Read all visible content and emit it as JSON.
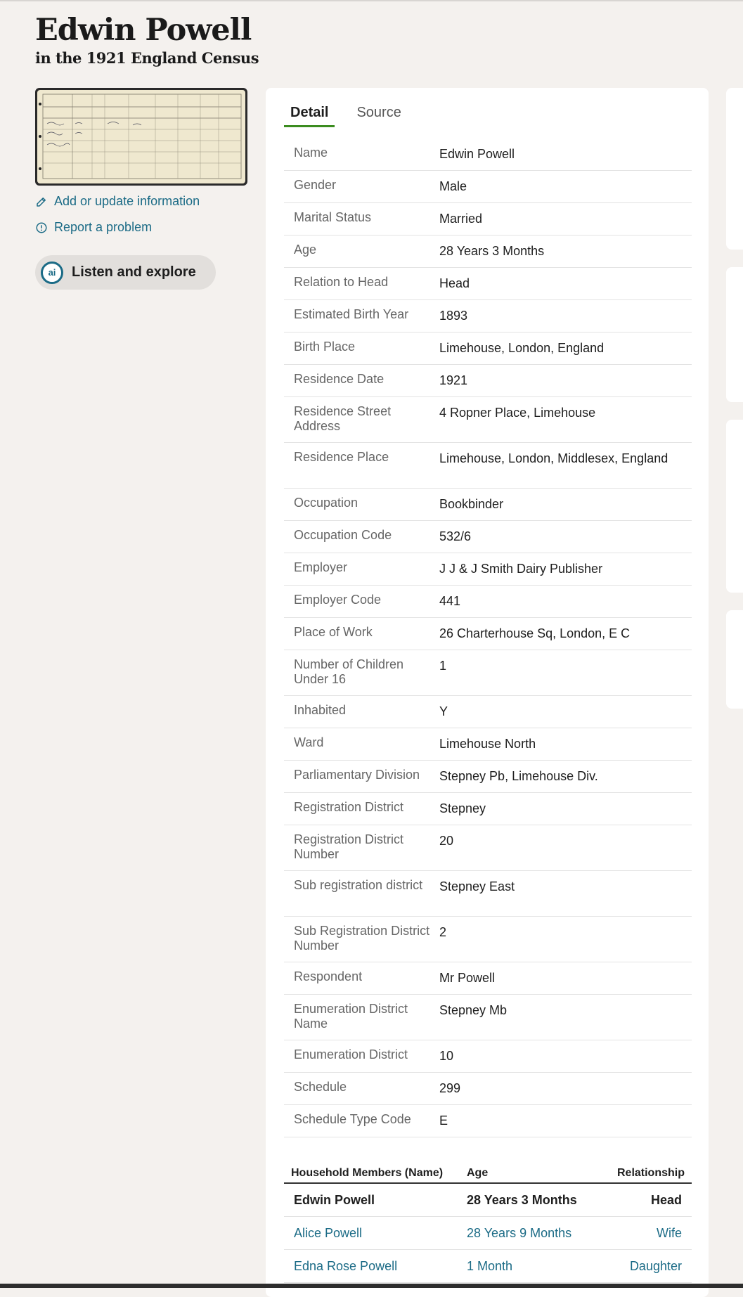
{
  "header": {
    "name": "Edwin Powell",
    "collection": "in the 1921 England Census"
  },
  "sidebar": {
    "add_update_label": "Add or update information",
    "report_label": "Report a problem",
    "listen_label": "Listen and explore",
    "ai_badge": "ai"
  },
  "tabs": [
    {
      "label": "Detail",
      "active": true
    },
    {
      "label": "Source",
      "active": false
    }
  ],
  "details": [
    {
      "label": "Name",
      "value": "Edwin Powell"
    },
    {
      "label": "Gender",
      "value": "Male"
    },
    {
      "label": "Marital Status",
      "value": "Married"
    },
    {
      "label": "Age",
      "value": "28 Years 3 Months"
    },
    {
      "label": "Relation to Head",
      "value": "Head"
    },
    {
      "label": "Estimated Birth Year",
      "value": "1893"
    },
    {
      "label": "Birth Place",
      "value": "Limehouse, London, England"
    },
    {
      "label": "Residence Date",
      "value": "1921"
    },
    {
      "label": "Residence Street Address",
      "value": "4 Ropner Place, Limehouse"
    },
    {
      "label": "Residence Place",
      "value": "Limehouse, London, Middlesex, England"
    },
    {
      "label": "Occupation",
      "value": "Bookbinder"
    },
    {
      "label": "Occupation Code",
      "value": "532/6"
    },
    {
      "label": "Employer",
      "value": "J J & J Smith Dairy Publisher"
    },
    {
      "label": "Employer Code",
      "value": "441"
    },
    {
      "label": "Place of Work",
      "value": "26 Charterhouse Sq, London, E C"
    },
    {
      "label": "Number of Children Under 16",
      "value": "1"
    },
    {
      "label": "Inhabited",
      "value": "Y"
    },
    {
      "label": "Ward",
      "value": "Limehouse North"
    },
    {
      "label": "Parliamentary Division",
      "value": "Stepney Pb, Limehouse Div."
    },
    {
      "label": "Registration District",
      "value": "Stepney"
    },
    {
      "label": "Registration District Number",
      "value": "20"
    },
    {
      "label": "Sub registration district",
      "value": "Stepney East"
    },
    {
      "label": "Sub Registration District Number",
      "value": "2"
    },
    {
      "label": "Respondent",
      "value": "Mr Powell"
    },
    {
      "label": "Enumeration District Name",
      "value": "Stepney Mb"
    },
    {
      "label": "Enumeration District",
      "value": "10"
    },
    {
      "label": "Schedule",
      "value": "299"
    },
    {
      "label": "Schedule Type Code",
      "value": "E"
    }
  ],
  "household": {
    "headers": [
      "Household Members (Name)",
      "Age",
      "Relationship"
    ],
    "members": [
      {
        "name": "Edwin Powell",
        "age": "28 Years 3 Months",
        "relationship": "Head"
      },
      {
        "name": "Alice Powell",
        "age": "28 Years 9 Months",
        "relationship": "Wife"
      },
      {
        "name": "Edna Rose Powell",
        "age": "1 Month",
        "relationship": "Daughter"
      }
    ]
  },
  "colors": {
    "link": "#1b6b86",
    "tab_active_underline": "#3b8c1f",
    "background": "#f4f1ee"
  }
}
